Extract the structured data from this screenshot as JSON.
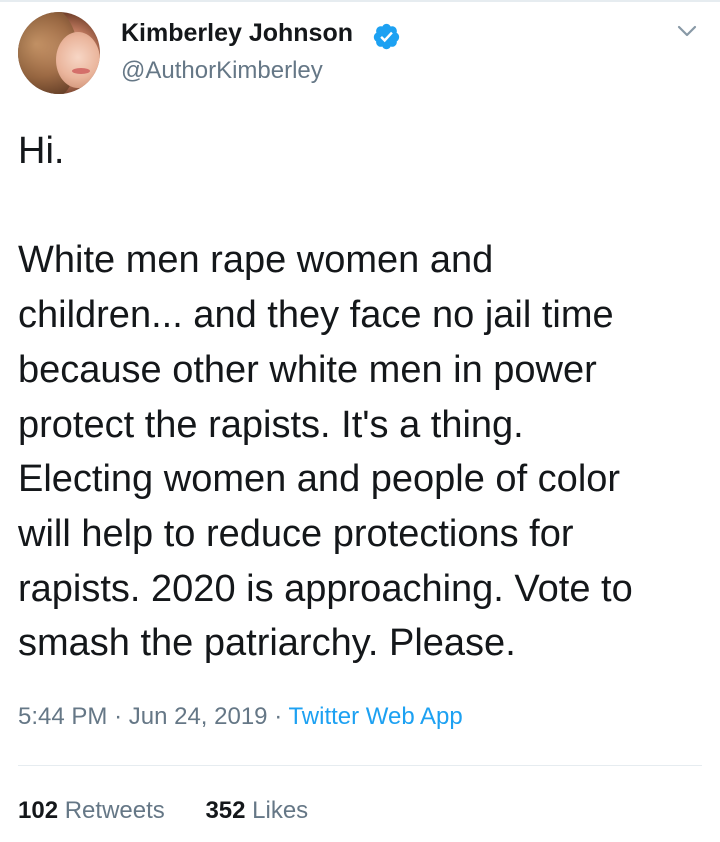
{
  "tweet": {
    "author": {
      "display_name": "Kimberley Johnson",
      "handle": "@AuthorKimberley",
      "verified": true,
      "verified_icon": "verified-badge-icon",
      "avatar": "profile-photo"
    },
    "menu_icon": "chevron-down-icon",
    "text_lines": [
      "Hi.",
      "",
      "White men rape women and",
      "children... and they face no jail time",
      "because other white men in power",
      "protect the rapists. It's a thing.",
      "Electing women and people of color",
      "will help to reduce protections for",
      "rapists. 2020 is approaching. Vote to",
      "smash the patriarchy. Please."
    ],
    "time": "5:44 PM",
    "separator": "·",
    "date": "Jun 24, 2019",
    "source": "Twitter Web App",
    "retweets_count": "102",
    "retweets_label": "Retweets",
    "likes_count": "352",
    "likes_label": "Likes"
  },
  "colors": {
    "text": "#14171a",
    "secondary": "#657786",
    "link": "#1da1f2",
    "divider": "#e6ecf0"
  }
}
